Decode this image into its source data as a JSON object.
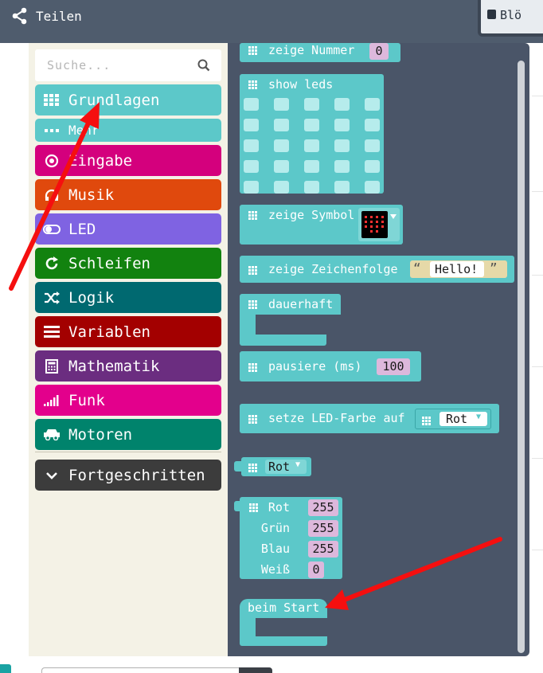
{
  "header": {
    "share_label": "Teilen",
    "blocks_tab_label": "Blö"
  },
  "search": {
    "placeholder": "Suche..."
  },
  "categories": [
    {
      "label": "Grundlagen",
      "color": "#5cc8c9",
      "icon": "grid-icon"
    },
    {
      "label": "Mehr",
      "color": "#5cc8c9",
      "icon": "dots-icon"
    },
    {
      "label": "Eingabe",
      "color": "#d4007d",
      "icon": "target-icon"
    },
    {
      "label": "Musik",
      "color": "#e0490d",
      "icon": "headphones-icon"
    },
    {
      "label": "LED",
      "color": "#7f63e2",
      "icon": "toggle-icon"
    },
    {
      "label": "Schleifen",
      "color": "#12820f",
      "icon": "refresh-icon"
    },
    {
      "label": "Logik",
      "color": "#006970",
      "icon": "shuffle-icon"
    },
    {
      "label": "Variablen",
      "color": "#a30000",
      "icon": "list-icon"
    },
    {
      "label": "Mathematik",
      "color": "#6b2d80",
      "icon": "calculator-icon"
    },
    {
      "label": "Funk",
      "color": "#e3008c",
      "icon": "signal-icon"
    },
    {
      "label": "Motoren",
      "color": "#00836c",
      "icon": "car-icon"
    },
    {
      "label": "Fortgeschritten",
      "color": "#3c3c3c",
      "icon": "chevron-down-icon"
    }
  ],
  "flyout": {
    "show_number": {
      "label": "zeige Nummer",
      "value": "0"
    },
    "show_leds": {
      "label": "show leds"
    },
    "show_icon": {
      "label": "zeige Symbol"
    },
    "show_string": {
      "label": "zeige Zeichenfolge",
      "open_quote": "“",
      "value": "Hello!",
      "close_quote": "”"
    },
    "forever": {
      "label": "dauerhaft"
    },
    "pause": {
      "label": "pausiere (ms)",
      "value": "100"
    },
    "set_led_color": {
      "label": "setze LED-Farbe auf",
      "value": "Rot"
    },
    "color_dropdown": {
      "value": "Rot"
    },
    "rgb": {
      "rows": [
        {
          "label": "Rot",
          "value": "255"
        },
        {
          "label": "Grün",
          "value": "255"
        },
        {
          "label": "Blau",
          "value": "255"
        },
        {
          "label": "Weiß",
          "value": "0"
        }
      ]
    },
    "on_start": {
      "label": "beim Start"
    }
  },
  "colors": {
    "header_bg": "#4f5c6d",
    "flyout_bg": "#4a5568",
    "toolbox_bg": "#f4f2e6",
    "block_teal": "#5cc8c9",
    "arrow_red": "#f50f0f"
  }
}
